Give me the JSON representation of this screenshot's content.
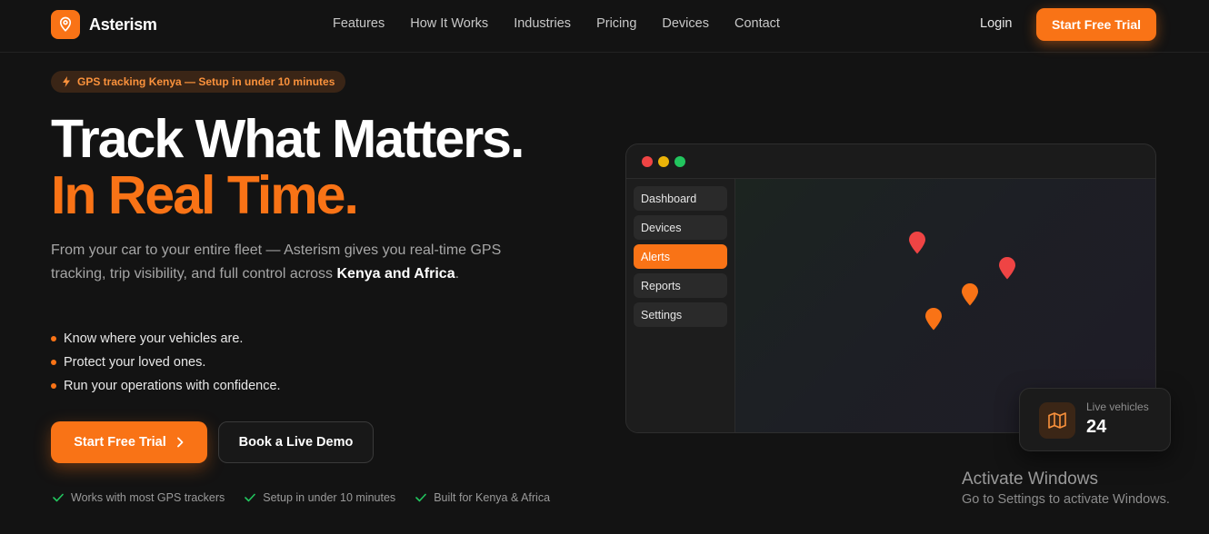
{
  "brand": {
    "name": "Asterism",
    "accent": "#f97316"
  },
  "nav": {
    "links": [
      "Features",
      "How It Works",
      "Industries",
      "Pricing",
      "Devices",
      "Contact"
    ],
    "login": "Login",
    "cta": "Start Free Trial"
  },
  "hero": {
    "badge": "GPS tracking Kenya — Setup in under 10 minutes",
    "title_line1": "Track What Matters.",
    "title_line2": "In Real Time.",
    "lead_prefix": "From your car to your entire fleet — Asterism gives you real-time GPS tracking, trip visibility, and full control across ",
    "lead_bold": "Kenya and Africa",
    "lead_suffix": ".",
    "bullets": [
      "Know where your vehicles are.",
      "Protect your loved ones.",
      "Run your operations with confidence."
    ],
    "primary_cta": "Start Free Trial",
    "secondary_cta": "Book a Live Demo",
    "trust": [
      "Works with most GPS trackers",
      "Setup in under 10 minutes",
      "Built for Kenya & Africa"
    ]
  },
  "mockup": {
    "window_dots": [
      "#ef4444",
      "#eab308",
      "#22c55e"
    ],
    "sidebar": [
      "Dashboard",
      "Devices",
      "Alerts",
      "Reports",
      "Settings"
    ],
    "active_item": "Alerts",
    "pin_colors": {
      "alert": "#ef4444",
      "vehicle": "#f97316"
    }
  },
  "live_card": {
    "label": "Live vehicles",
    "value": "24",
    "icon": "map-icon"
  },
  "watermark": {
    "title": "Activate Windows",
    "subtitle": "Go to Settings to activate Windows."
  }
}
